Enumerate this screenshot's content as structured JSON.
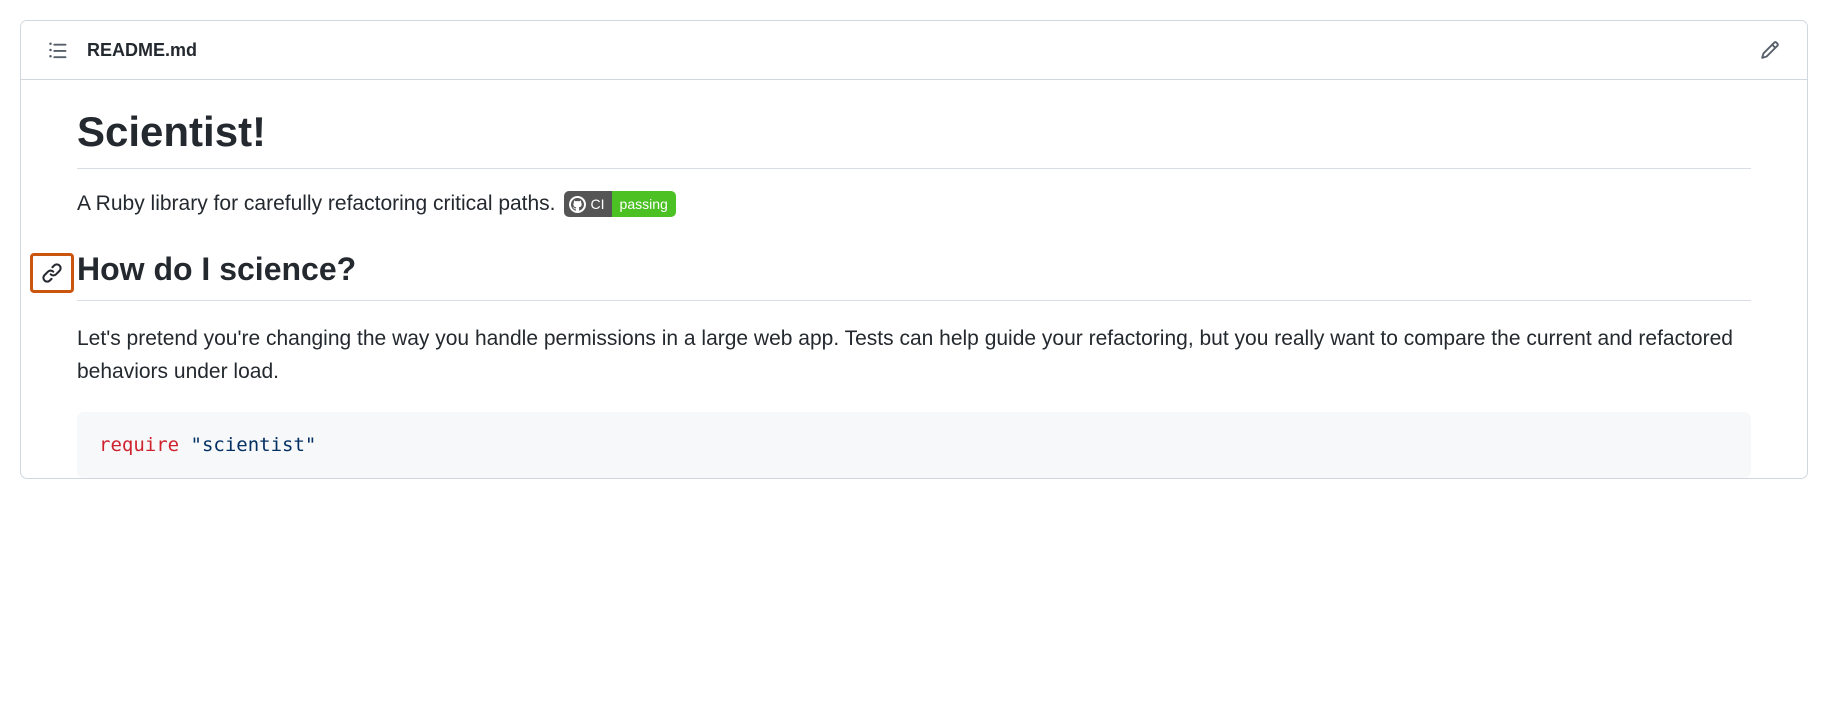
{
  "header": {
    "filename": "README.md"
  },
  "content": {
    "title": "Scientist!",
    "description": "A Ruby library for carefully refactoring critical paths.",
    "badge": {
      "label": "CI",
      "status": "passing"
    },
    "section_heading": "How do I science?",
    "section_paragraph": "Let's pretend you're changing the way you handle permissions in a large web app. Tests can help guide your refactoring, but you really want to compare the current and refactored behaviors under load.",
    "code": {
      "keyword": "require",
      "string": "\"scientist\""
    }
  }
}
